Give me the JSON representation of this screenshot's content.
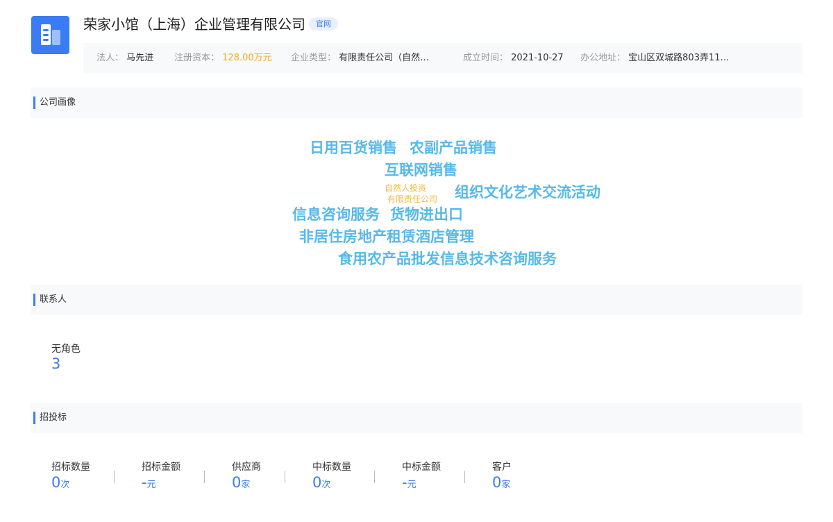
{
  "header": {
    "company_name": "荣家小馆（上海）企业管理有限公司",
    "official_badge": "官网",
    "info": [
      {
        "label": "法人：",
        "value": "马先进"
      },
      {
        "label": "注册资本：",
        "value": "128.00万元"
      },
      {
        "label": "企业类型：",
        "value": "有限责任公司（自然…"
      },
      {
        "label": "成立时间：",
        "value": "2021-10-27"
      },
      {
        "label": "办公地址：",
        "value": "宝山区双城路803弄11…"
      }
    ]
  },
  "portrait": {
    "title": "公司画像",
    "words": [
      "日用百货销售",
      "农副产品销售",
      "互联网销售",
      "自然人投资",
      "有限责任公司",
      "组织文化艺术交流活动",
      "信息咨询服务",
      "货物进出口",
      "非居住房地产租赁酒店管理",
      "食用农产品批发信息技术咨询服务"
    ]
  },
  "contacts": {
    "title": "联系人",
    "items": [
      {
        "label": "无角色",
        "value": "3"
      }
    ]
  },
  "bidding": {
    "title": "招投标",
    "stats": [
      {
        "label": "招标数量",
        "value": "0",
        "unit": "次"
      },
      {
        "label": "招标金额",
        "value": "-",
        "unit": "元"
      },
      {
        "label": "供应商",
        "value": "0",
        "unit": "家"
      },
      {
        "label": "中标数量",
        "value": "0",
        "unit": "次"
      },
      {
        "label": "中标金额",
        "value": "-",
        "unit": "元"
      },
      {
        "label": "客户",
        "value": "0",
        "unit": "家"
      }
    ]
  },
  "colors": {
    "accent_blue": "#3a7cf3",
    "tag_blue": "#56b9ea",
    "tag_orange": "#f5b841",
    "capital_orange": "#f5a623"
  }
}
